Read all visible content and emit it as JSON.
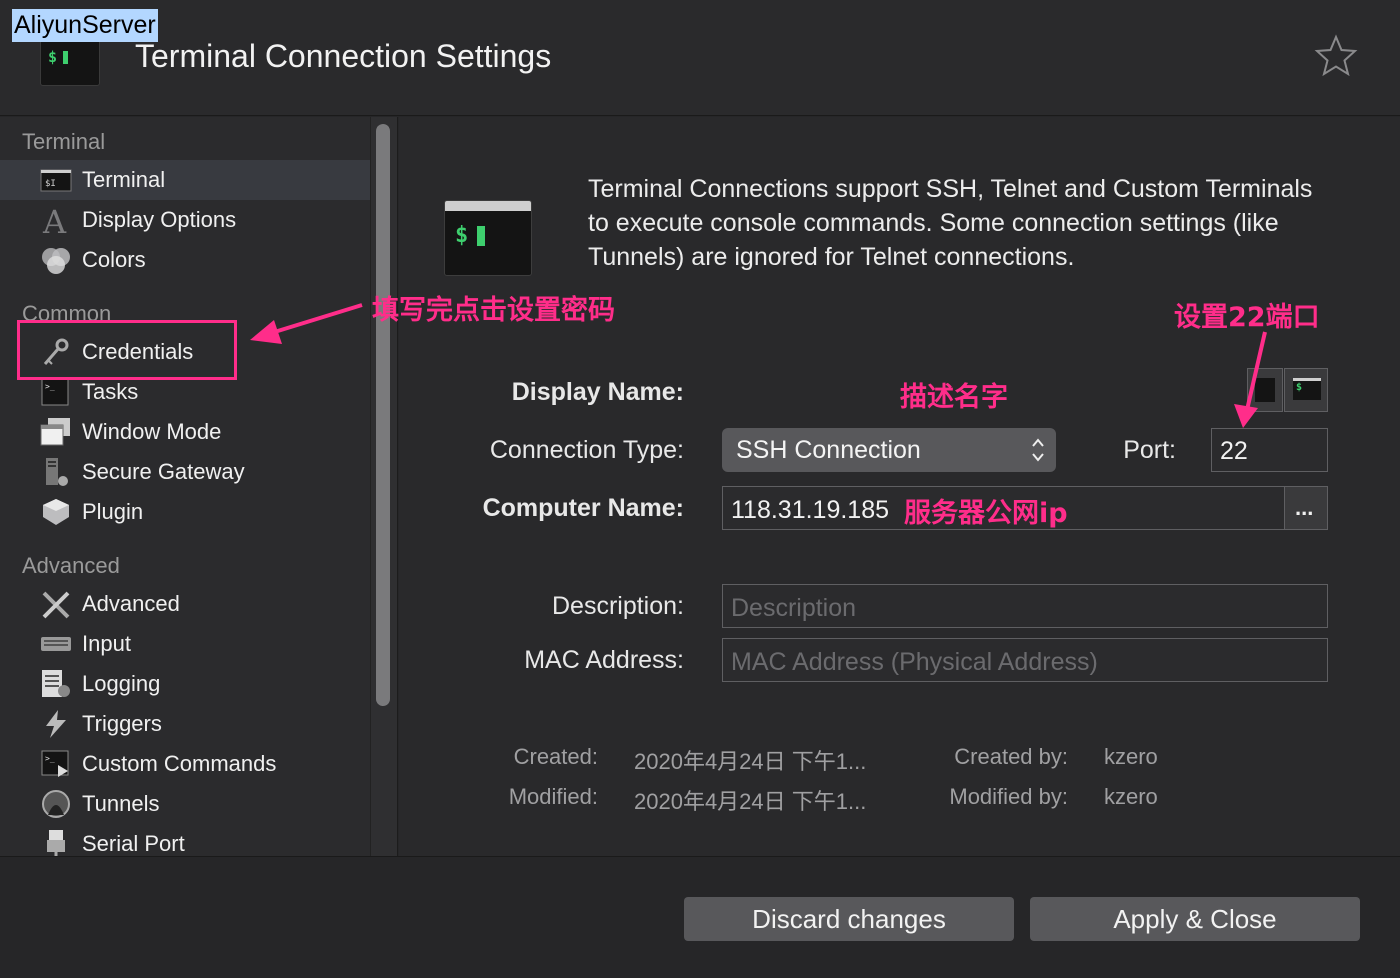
{
  "header": {
    "title": "Terminal Connection Settings",
    "favorite_icon": "star-icon",
    "app_icon_prompt": "$"
  },
  "sidebar": {
    "sections": [
      {
        "heading": "Terminal",
        "items": [
          {
            "label": "Terminal",
            "icon": "terminal-icon",
            "selected": true
          },
          {
            "label": "Display Options",
            "icon": "font-icon"
          },
          {
            "label": "Colors",
            "icon": "colors-icon"
          }
        ]
      },
      {
        "heading": "Common",
        "items": [
          {
            "label": "Credentials",
            "icon": "key-icon"
          },
          {
            "label": "Tasks",
            "icon": "tasks-icon"
          },
          {
            "label": "Window Mode",
            "icon": "window-icon"
          },
          {
            "label": "Secure Gateway",
            "icon": "gateway-icon"
          },
          {
            "label": "Plugin",
            "icon": "plugin-icon"
          }
        ]
      },
      {
        "heading": "Advanced",
        "items": [
          {
            "label": "Advanced",
            "icon": "tools-icon"
          },
          {
            "label": "Input",
            "icon": "keyboard-icon"
          },
          {
            "label": "Logging",
            "icon": "log-icon"
          },
          {
            "label": "Triggers",
            "icon": "lightning-icon"
          },
          {
            "label": "Custom Commands",
            "icon": "commands-icon"
          },
          {
            "label": "Tunnels",
            "icon": "tunnel-icon"
          },
          {
            "label": "Serial Port",
            "icon": "serial-port-icon"
          }
        ]
      }
    ]
  },
  "main": {
    "info_text": "Terminal Connections support SSH, Telnet and Custom Terminals to execute console commands. Some connection settings (like Tunnels) are ignored for Telnet connections.",
    "big_icon_prompt": "$",
    "display_name": {
      "label": "Display Name:",
      "value": "AliyunServer"
    },
    "connection_type": {
      "label": "Connection Type:",
      "value": "SSH Connection"
    },
    "port": {
      "label": "Port:",
      "value": "22"
    },
    "computer_name": {
      "label": "Computer Name:",
      "value": "118.31.19.185",
      "browse_label": "..."
    },
    "description": {
      "label": "Description:",
      "placeholder": "Description"
    },
    "mac_address": {
      "label": "MAC Address:",
      "placeholder": "MAC Address (Physical Address)"
    },
    "meta": {
      "created_label": "Created:",
      "created_value": "2020年4月24日 下午1...",
      "modified_label": "Modified:",
      "modified_value": "2020年4月24日 下午1...",
      "created_by_label": "Created by:",
      "created_by_value": "kzero",
      "modified_by_label": "Modified by:",
      "modified_by_value": "kzero"
    }
  },
  "footer": {
    "discard_label": "Discard changes",
    "apply_label": "Apply & Close"
  },
  "annotations": {
    "credentials_note": "填写完点击设置密码",
    "port_note": "设置22端口",
    "display_name_note": "描述名字",
    "computer_name_note": "服务器公网ip",
    "color": "#ff2d8a"
  }
}
